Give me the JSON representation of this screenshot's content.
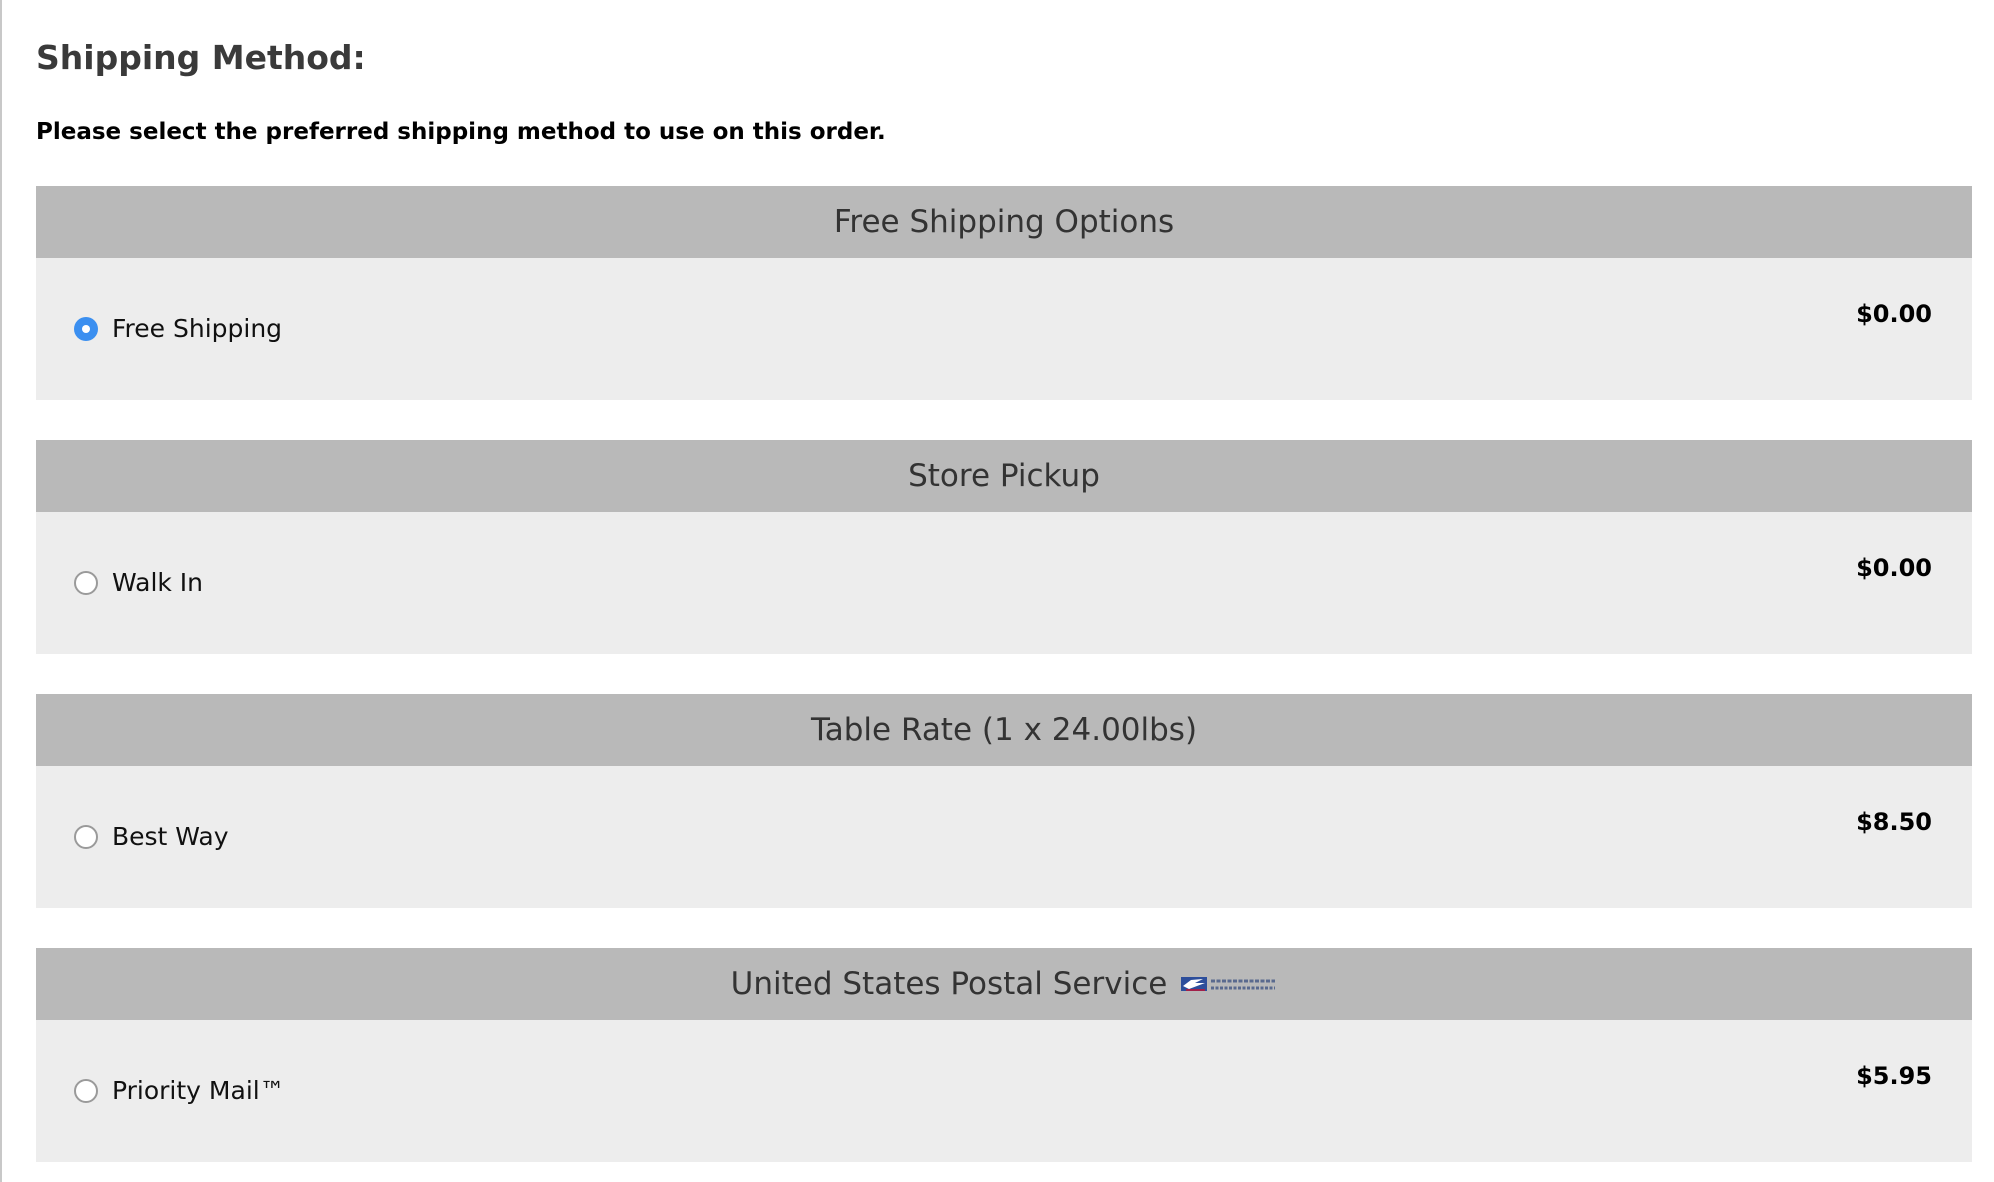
{
  "page": {
    "title": "Shipping Method:",
    "instruction": "Please select the preferred shipping method to use on this order."
  },
  "groups": [
    {
      "header": "Free Shipping Options",
      "option": {
        "label": "Free Shipping",
        "price": "$0.00",
        "selected": true
      }
    },
    {
      "header": "Store Pickup",
      "option": {
        "label": "Walk In",
        "price": "$0.00",
        "selected": false
      }
    },
    {
      "header": "Table Rate (1 x 24.00lbs)",
      "option": {
        "label": "Best Way",
        "price": "$8.50",
        "selected": false
      }
    },
    {
      "header": "United States Postal Service",
      "logo_text": "UNITED STATES POSTAL SERVICE",
      "option": {
        "label": "Priority Mail™",
        "price": "$5.95",
        "selected": false
      }
    }
  ],
  "colors": {
    "header_bg": "#b9b9b9",
    "body_bg": "#ededed",
    "radio_selected": "#3b8ff0",
    "usps_blue": "#2d4e9b"
  },
  "icons": {
    "radio_selected": "radio-checked-icon",
    "radio_unselected": "radio-unchecked-icon",
    "carrier_logo": "usps-eagle-logo"
  }
}
